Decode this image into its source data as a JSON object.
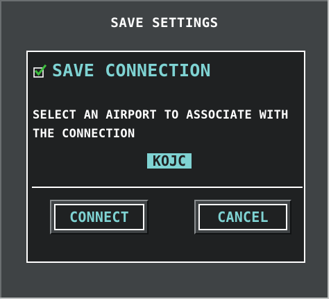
{
  "dialog": {
    "title": "SAVE SETTINGS",
    "save_connection": {
      "label": "SAVE CONNECTION",
      "checked": true,
      "icon": "checkmark-icon",
      "check_color": "#3fbf3f"
    },
    "instruction": "SELECT AN AIRPORT TO ASSOCIATE WITH THE CONNECTION",
    "airport_code": "KOJC",
    "buttons": {
      "connect": "CONNECT",
      "cancel": "CANCEL"
    }
  },
  "colors": {
    "accent_cyan": "#7fd3d3",
    "panel_bg": "#1f2122",
    "window_bg": "#3f4345",
    "text": "#ffffff"
  }
}
